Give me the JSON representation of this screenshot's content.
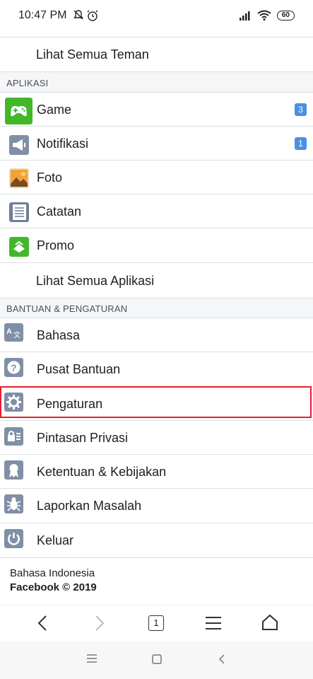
{
  "status": {
    "time": "10:47 PM",
    "battery": "60"
  },
  "friends": {
    "see_all": "Lihat Semua Teman"
  },
  "apps_section": {
    "title": "APLIKASI",
    "items": [
      {
        "label": "Game",
        "badge": "3",
        "icon": "game-controller-icon"
      },
      {
        "label": "Notifikasi",
        "badge": "1",
        "icon": "megaphone-icon"
      },
      {
        "label": "Foto",
        "icon": "photo-icon"
      },
      {
        "label": "Catatan",
        "icon": "notes-icon"
      },
      {
        "label": "Promo",
        "icon": "promo-icon"
      }
    ],
    "see_all": "Lihat Semua Aplikasi"
  },
  "help_section": {
    "title": "BANTUAN & PENGATURAN",
    "items": [
      {
        "label": "Bahasa",
        "icon": "language-icon"
      },
      {
        "label": "Pusat Bantuan",
        "icon": "help-icon"
      },
      {
        "label": "Pengaturan",
        "icon": "gear-icon"
      },
      {
        "label": "Pintasan Privasi",
        "icon": "privacy-lock-icon"
      },
      {
        "label": "Ketentuan & Kebijakan",
        "icon": "terms-ribbon-icon"
      },
      {
        "label": "Laporkan Masalah",
        "icon": "bug-icon"
      },
      {
        "label": "Keluar",
        "icon": "power-icon"
      }
    ]
  },
  "footer": {
    "language": "Bahasa Indonesia",
    "copyright": "Facebook © 2019"
  },
  "browser": {
    "tab_count": "1"
  },
  "colors": {
    "highlight": "#e3202e",
    "badge": "#4a90e2",
    "section_bg": "#f5f6f7"
  }
}
